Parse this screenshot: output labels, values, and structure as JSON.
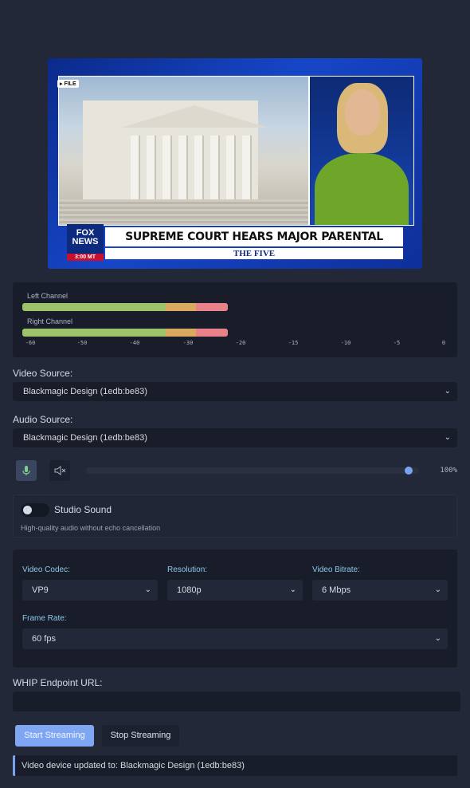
{
  "preview": {
    "file_tag": "▸ FILE",
    "logo_line1": "FOX",
    "logo_line2": "NEWS",
    "logo_time": "3:00 MT",
    "headline": "SUPREME COURT HEARS MAJOR PARENTAL RIGHTS CASE",
    "show_name": "THE FIVE"
  },
  "meters": {
    "left_label": "Left Channel",
    "right_label": "Right Channel",
    "left_level_fraction": 0.43,
    "right_level_fraction": 0.43,
    "scale": [
      "-60",
      "-50",
      "-40",
      "-30",
      "-20",
      "-15",
      "-10",
      "-5",
      "0"
    ],
    "colors": {
      "green": "#9bc46b",
      "orange": "#dba862",
      "red": "#e8828a"
    }
  },
  "video_source": {
    "label": "Video Source:",
    "value": "Blackmagic Design (1edb:be83)"
  },
  "audio_source": {
    "label": "Audio Source:",
    "value": "Blackmagic Design (1edb:be83)"
  },
  "volume": {
    "mic_icon": "mic-icon",
    "mute_icon": "speaker-mute-icon",
    "level": 1.0,
    "display": "100%"
  },
  "studio_sound": {
    "title": "Studio Sound",
    "description": "High-quality audio without echo cancellation",
    "enabled": false
  },
  "codec": {
    "video_codec_label": "Video Codec:",
    "video_codec_value": "VP9",
    "resolution_label": "Resolution:",
    "resolution_value": "1080p",
    "bitrate_label": "Video Bitrate:",
    "bitrate_value": "6 Mbps",
    "frame_rate_label": "Frame Rate:",
    "frame_rate_value": "60 fps"
  },
  "whip": {
    "label": "WHIP Endpoint URL:",
    "value": ""
  },
  "buttons": {
    "start": "Start Streaming",
    "stop": "Stop Streaming"
  },
  "status": {
    "message": "Video device updated to: Blackmagic Design (1edb:be83)"
  },
  "accent_color": "#7aa2f0"
}
